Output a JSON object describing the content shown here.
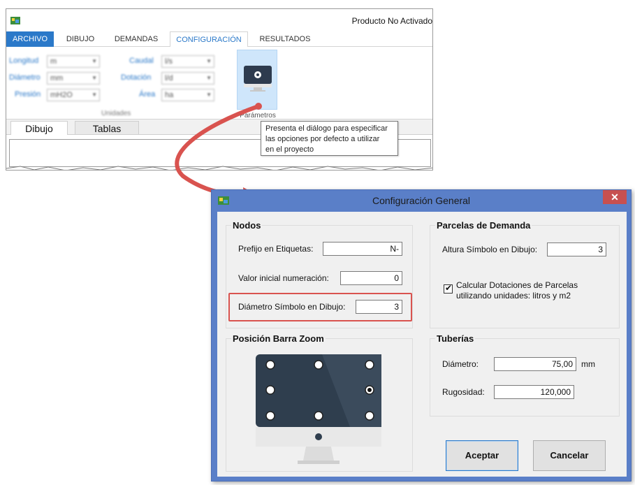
{
  "ribbon": {
    "status": "Producto No Activado",
    "tabs": [
      "ARCHIVO",
      "DIBUJO",
      "DEMANDAS",
      "CONFIGURACIÓN",
      "RESULTADOS"
    ],
    "units_group": {
      "longitud": {
        "label": "Longitud",
        "value": "m"
      },
      "diametro": {
        "label": "Diámetro",
        "value": "mm"
      },
      "presion": {
        "label": "Presión",
        "value": "mH2O"
      },
      "caudal": {
        "label": "Caudal",
        "value": "l/s"
      },
      "dotacion": {
        "label": "Dotación",
        "value": "l/d"
      },
      "area": {
        "label": "Área",
        "value": "ha"
      },
      "caption": "Unidades"
    },
    "params_button_label": "Parámetros",
    "doc_tabs": [
      "Dibujo",
      "Tablas"
    ],
    "tooltip": [
      "Presenta el diálogo para especificar",
      "las opciones por defecto a utilizar",
      "en el proyecto"
    ]
  },
  "dialog": {
    "title": "Configuración General",
    "close_glyph": "✕",
    "nodos": {
      "title": "Nodos",
      "prefijo_label": "Prefijo en Etiquetas:",
      "prefijo_value": "N-",
      "valor_label": "Valor inicial numeración:",
      "valor_value": "0",
      "diametro_label": "Diámetro Símbolo en Dibujo:",
      "diametro_value": "3"
    },
    "parcelas": {
      "title": "Parcelas de Demanda",
      "altura_label": "Altura Símbolo en Dibujo:",
      "altura_value": "3",
      "checkbox_line1": "Calcular Dotaciones de Parcelas",
      "checkbox_line2": "utilizando unidades: litros y m2",
      "checked": true
    },
    "zoom": {
      "title": "Posición Barra Zoom",
      "selected_position": "middle-right"
    },
    "tuberias": {
      "title": "Tuberías",
      "diametro_label": "Diámetro:",
      "diametro_value": "75,00",
      "diametro_unit": "mm",
      "rugosidad_label": "Rugosidad:",
      "rugosidad_value": "120,000"
    },
    "accept_label": "Aceptar",
    "cancel_label": "Cancelar"
  },
  "colors": {
    "accent": "#2b79c9",
    "dialog_frame": "#5a7fc8",
    "highlight": "#d9534f",
    "close": "#c75050"
  }
}
